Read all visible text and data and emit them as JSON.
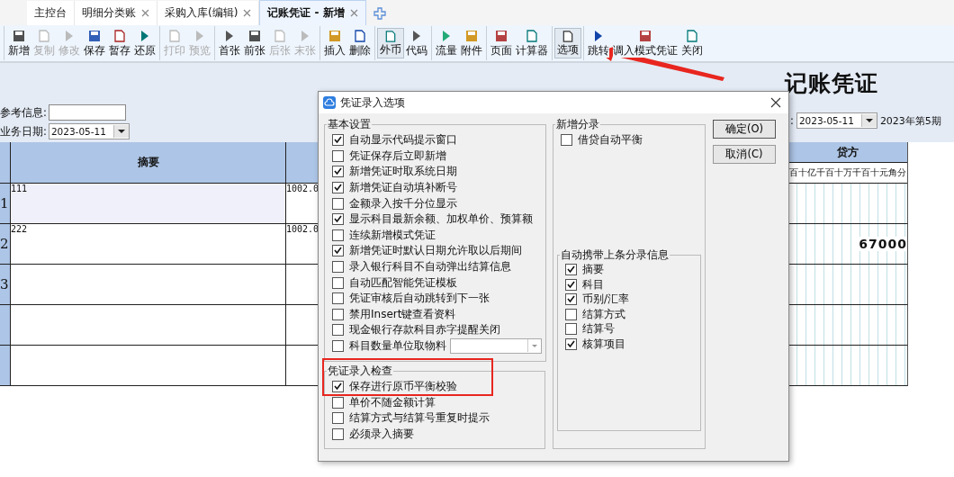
{
  "tabs": [
    {
      "label": "主控台",
      "closable": false,
      "selected": false
    },
    {
      "label": "明细分类账",
      "closable": true,
      "selected": false
    },
    {
      "label": "采购入库(编辑)",
      "closable": true,
      "selected": false
    },
    {
      "label": "记账凭证 - 新增",
      "closable": true,
      "selected": true
    }
  ],
  "toolbar": {
    "groups": [
      [
        {
          "label": "新增",
          "disabled": false,
          "pressed": false
        },
        {
          "label": "复制",
          "disabled": true,
          "pressed": false
        },
        {
          "label": "修改",
          "disabled": true,
          "pressed": false
        },
        {
          "label": "保存",
          "disabled": false,
          "pressed": false
        },
        {
          "label": "暂存",
          "disabled": false,
          "pressed": false
        },
        {
          "label": "还原",
          "disabled": false,
          "pressed": false
        }
      ],
      [
        {
          "label": "打印",
          "disabled": true,
          "pressed": false
        },
        {
          "label": "预览",
          "disabled": true,
          "pressed": false
        }
      ],
      [
        {
          "label": "首张",
          "disabled": false,
          "pressed": false
        },
        {
          "label": "前张",
          "disabled": false,
          "pressed": false
        },
        {
          "label": "后张",
          "disabled": true,
          "pressed": false
        },
        {
          "label": "末张",
          "disabled": true,
          "pressed": false
        }
      ],
      [
        {
          "label": "插入",
          "disabled": false,
          "pressed": false
        },
        {
          "label": "删除",
          "disabled": false,
          "pressed": false
        }
      ],
      [
        {
          "label": "外币",
          "disabled": false,
          "pressed": true
        },
        {
          "label": "代码",
          "disabled": false,
          "pressed": false
        }
      ],
      [
        {
          "label": "流量",
          "disabled": false,
          "pressed": false
        },
        {
          "label": "附件",
          "disabled": false,
          "pressed": false
        }
      ],
      [
        {
          "label": "页面",
          "disabled": false,
          "pressed": false
        },
        {
          "label": "计算器",
          "disabled": false,
          "pressed": false
        }
      ],
      [
        {
          "label": "选项",
          "disabled": false,
          "pressed": true
        }
      ],
      [
        {
          "label": "跳转",
          "disabled": false,
          "pressed": false
        },
        {
          "label": "调入模式凭证",
          "disabled": false,
          "pressed": false
        },
        {
          "label": "关闭",
          "disabled": false,
          "pressed": false
        }
      ]
    ]
  },
  "voucher": {
    "title": "记账凭证",
    "reference": {
      "label": "参考信息:"
    },
    "business_date": {
      "label": "业务日期:",
      "value": "2023-05-11"
    },
    "date": {
      "label": ":",
      "value": "2023-05-11"
    },
    "period": "2023年第5期",
    "columns": {
      "summary": "摘要",
      "credit": "贷方",
      "digits": [
        "百",
        "十",
        "亿",
        "千",
        "百",
        "十",
        "万",
        "千",
        "百",
        "十",
        "元",
        "角",
        "分"
      ]
    },
    "rows": [
      {
        "number": "1",
        "summary": "111",
        "account": "1002.0",
        "credit": "",
        "selected": true
      },
      {
        "number": "2",
        "summary": "222",
        "account": "1002.0",
        "credit": "67000",
        "selected": false
      },
      {
        "number": "3",
        "summary": "",
        "account": "",
        "credit": "",
        "selected": false
      },
      {
        "number": "",
        "summary": "",
        "account": "",
        "credit": "",
        "selected": false
      },
      {
        "number": "",
        "summary": "",
        "account": "",
        "credit": "",
        "selected": false
      }
    ]
  },
  "dialog": {
    "title": "凭证录入选项",
    "basic_settings": {
      "title": "基本设置",
      "items": [
        {
          "label": "自动显示代码提示窗口",
          "checked": true,
          "kind": "checkbox"
        },
        {
          "label": "凭证保存后立即新增",
          "checked": false,
          "kind": "checkbox"
        },
        {
          "label": "新增凭证时取系统日期",
          "checked": true,
          "kind": "checkbox"
        },
        {
          "label": "新增凭证自动填补断号",
          "checked": true,
          "kind": "checkbox"
        },
        {
          "label": "金额录入按千分位显示",
          "checked": false,
          "kind": "checkbox"
        },
        {
          "label": "显示科目最新余额、加权单价、预算额",
          "checked": true,
          "kind": "checkbox"
        },
        {
          "label": "连续新增模式凭证",
          "checked": false,
          "kind": "checkbox"
        },
        {
          "label": "新增凭证时默认日期允许取以后期间",
          "checked": true,
          "kind": "checkbox"
        },
        {
          "label": "录入银行科目不自动弹出结算信息",
          "checked": false,
          "kind": "checkbox"
        },
        {
          "label": "自动匹配智能凭证模板",
          "checked": false,
          "kind": "checkbox"
        },
        {
          "label": "凭证审核后自动跳转到下一张",
          "checked": false,
          "kind": "checkbox"
        },
        {
          "label": "禁用Insert键查看资料",
          "checked": false,
          "kind": "checkbox"
        },
        {
          "label": "现金银行存款科目赤字提醒关闭",
          "checked": false,
          "kind": "checkbox"
        },
        {
          "label": "科目数量单位取物料",
          "checked": false,
          "kind": "combo"
        }
      ]
    },
    "entry_check": {
      "title": "凭证录入检查",
      "items": [
        {
          "label": "保存进行原币平衡校验",
          "checked": true
        },
        {
          "label": "单价不随金额计算",
          "checked": false
        },
        {
          "label": "结算方式与结算号重复时提示",
          "checked": false
        },
        {
          "label": "必须录入摘要",
          "checked": false
        }
      ]
    },
    "new_entry": {
      "title": "新增分录",
      "items": [
        {
          "label": "借贷自动平衡",
          "checked": false
        }
      ]
    },
    "carry_over": {
      "title": "自动携带上条分录信息",
      "items": [
        {
          "label": "摘要",
          "checked": true
        },
        {
          "label": "科目",
          "checked": true
        },
        {
          "label": "币别/汇率",
          "checked": true
        },
        {
          "label": "结算方式",
          "checked": false
        },
        {
          "label": "结算号",
          "checked": false
        },
        {
          "label": "核算项目",
          "checked": true
        }
      ]
    },
    "buttons": [
      "确定(O)",
      "取消(C)"
    ]
  }
}
